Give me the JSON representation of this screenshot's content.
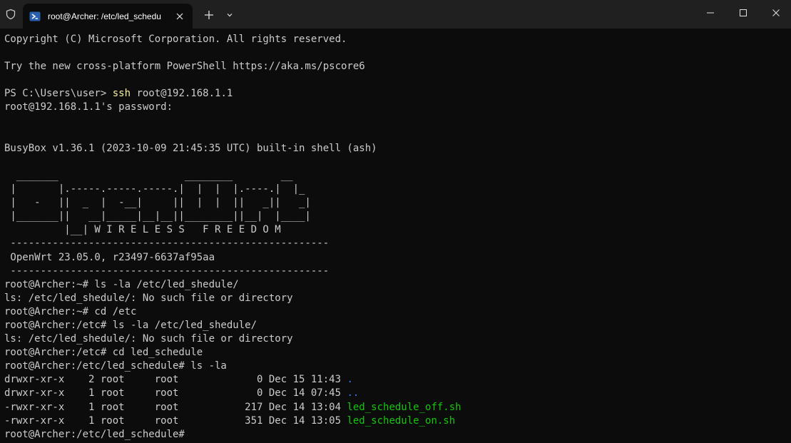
{
  "tab": {
    "title": "root@Archer: /etc/led_schedu"
  },
  "colors": {
    "prompt_cmd": "#f9f1a5",
    "dir": "#3b78ff",
    "exec": "#16c60c",
    "text": "#cccccc",
    "bg": "#0c0c0c"
  },
  "terminal": {
    "lines": [
      {
        "text": "Copyright (C) Microsoft Corporation. All rights reserved."
      },
      {
        "text": ""
      },
      {
        "text": "Try the new cross-platform PowerShell https://aka.ms/pscore6"
      },
      {
        "text": ""
      },
      {
        "pre": "PS C:\\Users\\user> ",
        "cmd": "ssh",
        "post": " root@192.168.1.1"
      },
      {
        "text": "root@192.168.1.1's password:"
      },
      {
        "text": ""
      },
      {
        "text": ""
      },
      {
        "text": "BusyBox v1.36.1 (2023-10-09 21:45:35 UTC) built-in shell (ash)"
      },
      {
        "text": ""
      },
      {
        "text": "  _______                     ________        __"
      },
      {
        "text": " |       |.-----.-----.-----.|  |  |  |.----.|  |_"
      },
      {
        "text": " |   -   ||  _  |  -__|     ||  |  |  ||   _||   _|"
      },
      {
        "text": " |_______||   __|_____|__|__||________||__|  |____|"
      },
      {
        "text": "          |__| W I R E L E S S   F R E E D O M"
      },
      {
        "text": " -----------------------------------------------------"
      },
      {
        "text": " OpenWrt 23.05.0, r23497-6637af95aa"
      },
      {
        "text": " -----------------------------------------------------"
      },
      {
        "text": "root@Archer:~# ls -la /etc/led_shedule/"
      },
      {
        "text": "ls: /etc/led_shedule/: No such file or directory"
      },
      {
        "text": "root@Archer:~# cd /etc"
      },
      {
        "text": "root@Archer:/etc# ls -la /etc/led_shedule/"
      },
      {
        "text": "ls: /etc/led_shedule/: No such file or directory"
      },
      {
        "text": "root@Archer:/etc# cd led_schedule"
      },
      {
        "text": "root@Archer:/etc/led_schedule# ls -la"
      },
      {
        "pre": "drwxr-xr-x    2 root     root             0 Dec 15 11:43 ",
        "entry": ".",
        "kind": "dir"
      },
      {
        "pre": "drwxr-xr-x    1 root     root             0 Dec 14 07:45 ",
        "entry": "..",
        "kind": "dir"
      },
      {
        "pre": "-rwxr-xr-x    1 root     root           217 Dec 14 13:04 ",
        "entry": "led_schedule_off.sh",
        "kind": "exec"
      },
      {
        "pre": "-rwxr-xr-x    1 root     root           351 Dec 14 13:05 ",
        "entry": "led_schedule_on.sh",
        "kind": "exec"
      },
      {
        "text": "root@Archer:/etc/led_schedule#"
      }
    ]
  }
}
